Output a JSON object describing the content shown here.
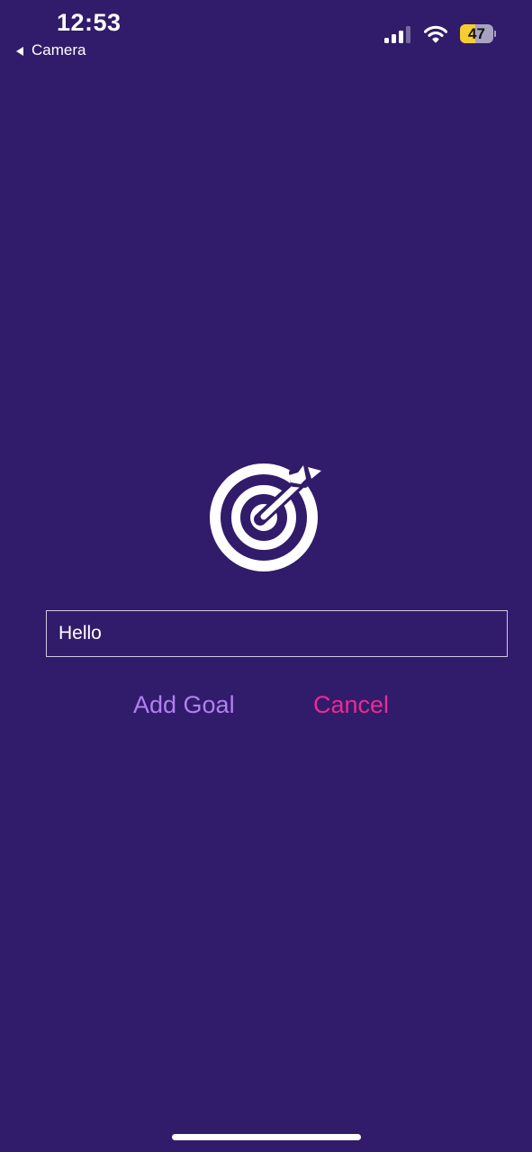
{
  "status_bar": {
    "time": "12:53",
    "back_label": "Camera",
    "battery_level": "47",
    "battery_fraction": 0.47,
    "signal_bars_active": 3,
    "signal_bars_total": 4
  },
  "goal_form": {
    "icon": "target-arrow-icon",
    "input_value": "Hello",
    "add_label": "Add Goal",
    "cancel_label": "Cancel"
  },
  "colors": {
    "background": "#311b6b",
    "add_button": "#b180f0",
    "cancel_button": "#ed2a91",
    "battery_fill": "#f6cd2e"
  }
}
